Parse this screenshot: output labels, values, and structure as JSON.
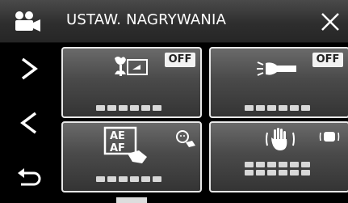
{
  "header": {
    "title": "USTAW. NAGRYWANIA",
    "mode_icon": "video-camera-icon",
    "close_icon": "close-icon"
  },
  "side_nav": [
    {
      "icon": "chevron-right-icon"
    },
    {
      "icon": "chevron-left-icon"
    },
    {
      "icon": "return-icon"
    }
  ],
  "tiles": [
    {
      "icon": "tele-macro-icon",
      "badge": "OFF"
    },
    {
      "icon": "video-light-icon",
      "badge": "OFF"
    },
    {
      "icon": "touch-ae-af-icon",
      "badge": ""
    },
    {
      "icon": "image-stabilizer-icon",
      "badge": ""
    }
  ],
  "colors": {
    "background": "#000000",
    "header": "#3a3a3a",
    "tile_border": "#e8e8e8",
    "badge": "#f2f2f2"
  }
}
